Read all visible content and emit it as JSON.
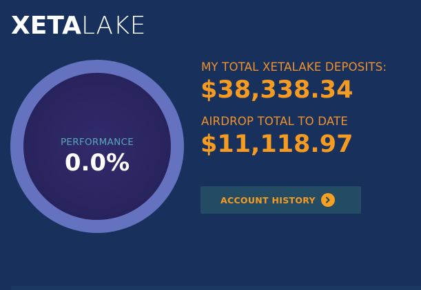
{
  "logo": {
    "bold": "XETA",
    "light": "LAKE"
  },
  "performance": {
    "label": "PERFORMANCE",
    "value": "0.0%"
  },
  "deposits": {
    "label": "MY TOTAL XETALAKE DEPOSITS:",
    "amount": "$38,338.34"
  },
  "airdrop": {
    "label": "AIRDROP TOTAL TO DATE",
    "amount": "$11,118.97"
  },
  "account_history_button": {
    "label": "ACCOUNT HISTORY",
    "icon": "chevron-right-icon"
  },
  "colors": {
    "background": "#17315c",
    "accent": "#f59b22",
    "ring": "#6472bf",
    "performance_label": "#57a7b5",
    "button_bg": "#244b64"
  }
}
